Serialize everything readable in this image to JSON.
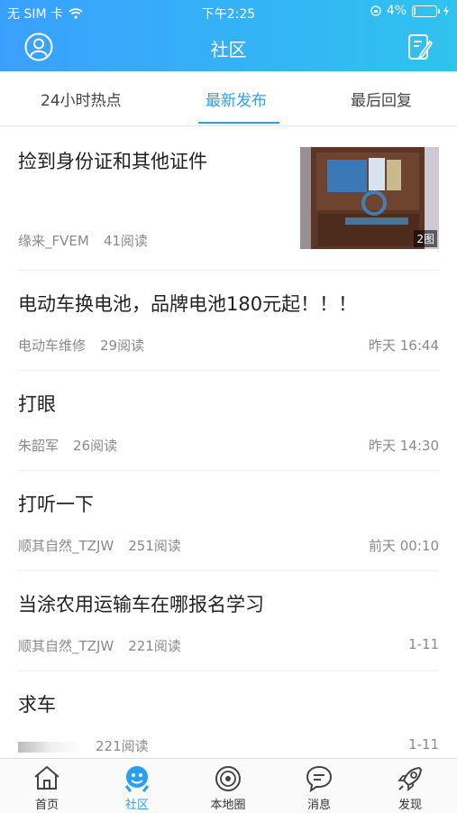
{
  "status": {
    "carrier": "无 SIM 卡",
    "time": "下午2:25",
    "battery": "4%"
  },
  "nav": {
    "title": "社区"
  },
  "tabs": [
    {
      "label": "24小时热点",
      "active": false
    },
    {
      "label": "最新发布",
      "active": true
    },
    {
      "label": "最后回复",
      "active": false
    }
  ],
  "posts": [
    {
      "title": "捡到身份证和其他证件",
      "author": "缘来_FVEM",
      "reads": "41阅读",
      "time": "",
      "image_badge": "2图"
    },
    {
      "title": "电动车换电池，品牌电池180元起！！！",
      "author": "电动车维修",
      "reads": "29阅读",
      "time": "昨天 16:44"
    },
    {
      "title": "打眼",
      "author": "朱韶军",
      "reads": "26阅读",
      "time": "昨天 14:30"
    },
    {
      "title": "打听一下",
      "author": "顺其自然_TZJW",
      "reads": "251阅读",
      "time": "前天 00:10"
    },
    {
      "title": "当涂农用运输车在哪报名学习",
      "author": "顺其自然_TZJW",
      "reads": "221阅读",
      "time": "1-11"
    },
    {
      "title": "求车",
      "author": "",
      "reads": "221阅读",
      "time": "1-11"
    }
  ],
  "bottom_nav": [
    {
      "label": "首页",
      "icon": "home-icon",
      "active": false
    },
    {
      "label": "社区",
      "icon": "community-icon",
      "active": true
    },
    {
      "label": "本地圈",
      "icon": "local-circle-icon",
      "active": false
    },
    {
      "label": "消息",
      "icon": "message-icon",
      "active": false
    },
    {
      "label": "发现",
      "icon": "discover-icon",
      "active": false
    }
  ],
  "colors": {
    "accent": "#2d9ff0",
    "header_start": "#3aa0ff",
    "header_end": "#2fc3ee"
  }
}
